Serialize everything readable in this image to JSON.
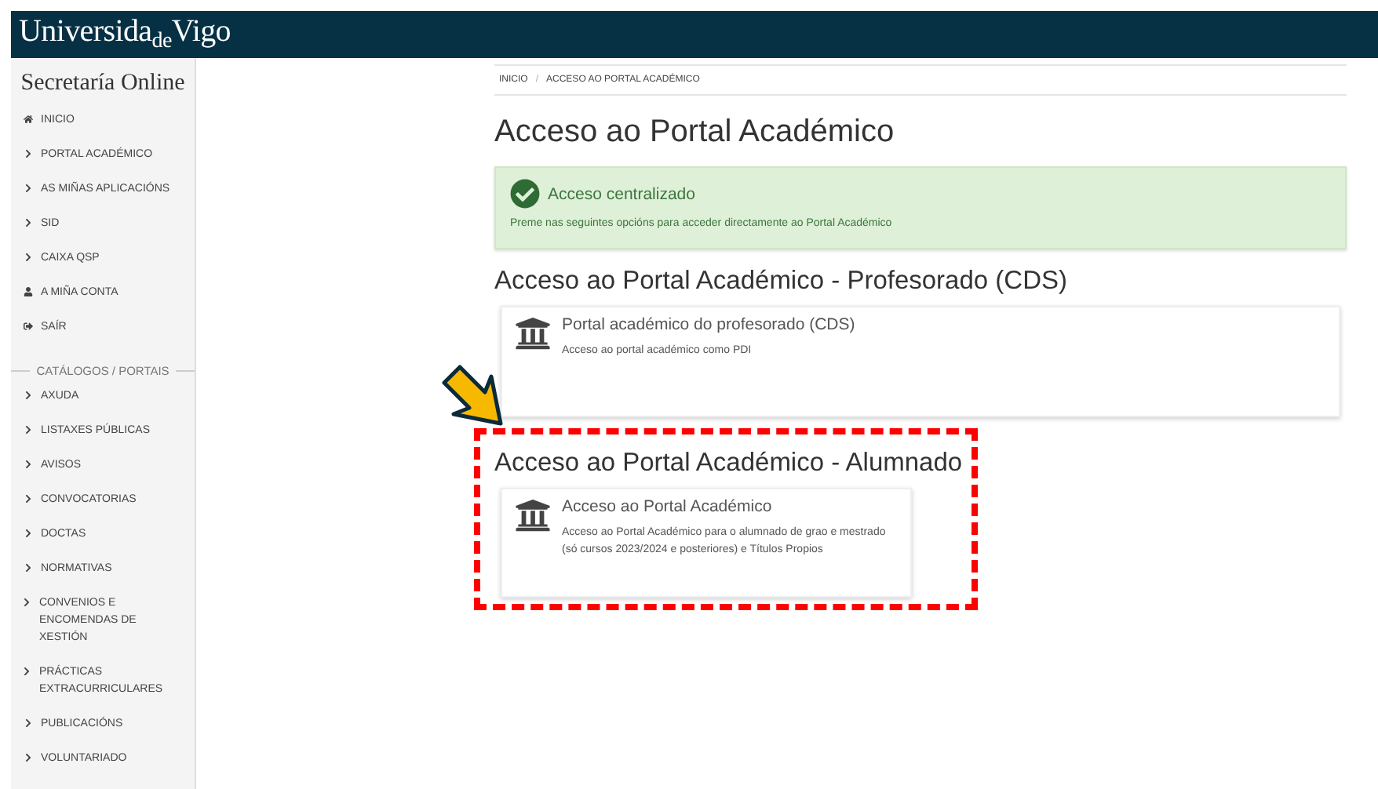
{
  "header": {
    "logo": "Universida$_{de}$Vigo"
  },
  "sidebar": {
    "title": "Secretaría Online",
    "items": [
      {
        "kind": "home",
        "label": "INICIO"
      },
      {
        "kind": "link",
        "label": "PORTAL ACADÉMICO"
      },
      {
        "kind": "link",
        "label": "AS MIÑAS APLICACIÓNS"
      },
      {
        "kind": "link",
        "label": "SID"
      },
      {
        "kind": "link",
        "label": "CAIXA QSP"
      },
      {
        "kind": "account",
        "label": "A MIÑA CONTA"
      },
      {
        "kind": "exit",
        "label": "SAÍR"
      },
      {
        "kind": "heading",
        "label": "CATÁLOGOS / PORTAIS"
      },
      {
        "kind": "link",
        "label": "AXUDA"
      },
      {
        "kind": "link",
        "label": "LISTAXES PÚBLICAS"
      },
      {
        "kind": "link",
        "label": "AVISOS"
      },
      {
        "kind": "link",
        "label": "CONVOCATORIAS"
      },
      {
        "kind": "link",
        "label": "DOCTAS"
      },
      {
        "kind": "link",
        "label": "NORMATIVAS"
      },
      {
        "kind": "link",
        "label": "CONVENIOS E ENCOMENDAS DE XESTIÓN"
      },
      {
        "kind": "link",
        "label": "PRÁCTICAS EXTRACURRICULARES"
      },
      {
        "kind": "link",
        "label": "PUBLICACIÓNS"
      },
      {
        "kind": "link",
        "label": "VOLUNTARIADO"
      }
    ]
  },
  "breadcrumb": [
    "INICIO",
    "/",
    "ACCESO AO PORTAL ACADÉMICO"
  ],
  "page_title": "Acceso ao Portal Académico",
  "alert": {
    "title": "Acceso centralizado",
    "text": "Preme nas seguintes opcións para acceder directamente ao Portal Académico"
  },
  "sections": [
    {
      "title": "Acceso ao Portal Académico - Profesorado (CDS)",
      "highlighted": false,
      "cards": [
        {
          "title": "Portal académico do profesorado (CDS)",
          "text": "Acceso ao portal académico como PDI"
        }
      ]
    },
    {
      "title": "Acceso ao Portal Académico - Alumnado",
      "highlighted": true,
      "cards": [
        {
          "title": "Acceso ao Portal Académico",
          "text": "Acceso ao Portal Académico para o alumnado de grao e mestrado (só cursos 2023/2024 e posteriores) e Títulos Propios"
        }
      ]
    }
  ]
}
